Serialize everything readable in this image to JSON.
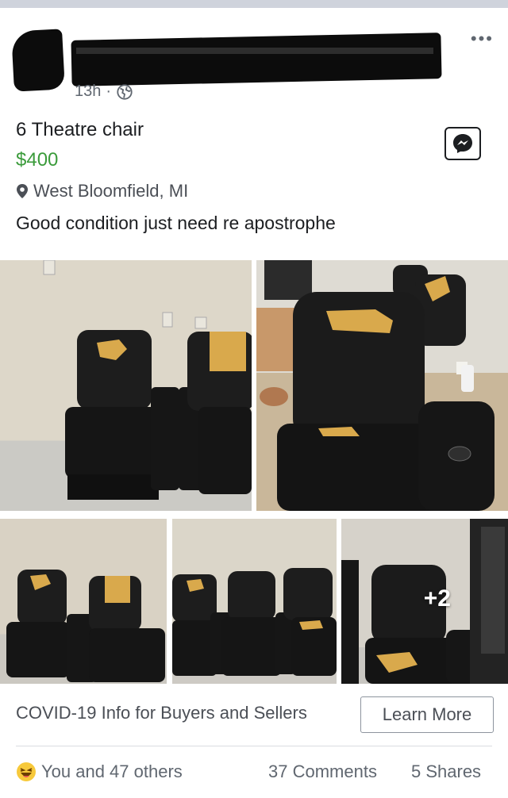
{
  "post": {
    "time": "13h",
    "separator": "·",
    "title": "6 Theatre chair",
    "price": "$400",
    "location": "West Bloomfield, MI",
    "description": "Good condition just need re apostrophe",
    "more_photos": "+2"
  },
  "covid": {
    "text": "COVID-19 Info for Buyers and Sellers",
    "button": "Learn More"
  },
  "footer": {
    "reactions": "You and 47 others",
    "comments": "37 Comments",
    "shares": "5 Shares"
  },
  "colors": {
    "price_green": "#3b9b3b",
    "chair_black": "#1b1b1b",
    "tear_yellow": "#d9a94c",
    "haha_yellow": "#f7c93b"
  },
  "icons": [
    "more-options-icon",
    "globe-icon",
    "location-pin-icon",
    "messenger-icon",
    "haha-reaction-icon"
  ]
}
